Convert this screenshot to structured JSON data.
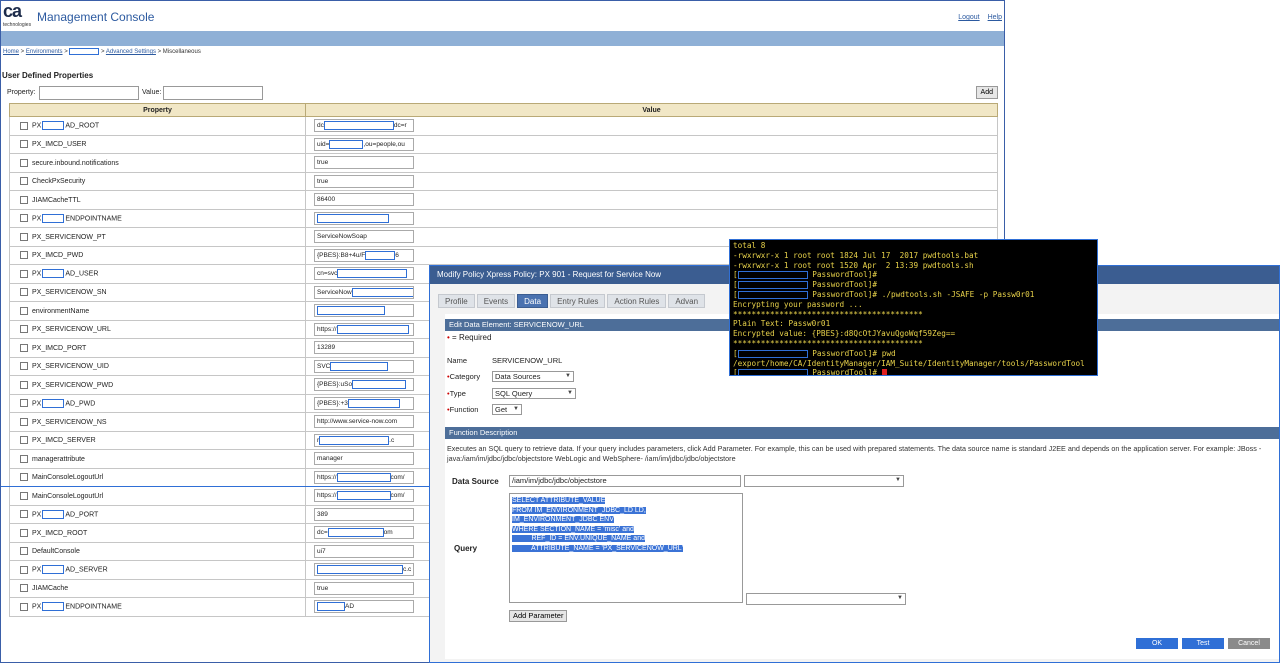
{
  "app": {
    "title": "Management Console",
    "logo_text": "ca",
    "logo_sub": "technologies",
    "links": [
      "Logout",
      "Help"
    ]
  },
  "breadcrumb": {
    "home": "Home",
    "environments": "Environments",
    "advanced": "Advanced Settings",
    "current": "Miscellaneous"
  },
  "udp": {
    "title": "User Defined Properties",
    "property_label": "Property:",
    "value_label": "Value:",
    "add_label": "Add",
    "col_property": "Property",
    "col_value": "Value"
  },
  "rows": [
    {
      "p1": "PX",
      "p2": "AD_ROOT",
      "v1": "dc",
      "v2": "dc=r"
    },
    {
      "p1": "PX_IMCD_USER",
      "p2": "",
      "v1": "uid=",
      "v2": ",ou=people,ou"
    },
    {
      "p1": "secure.inbound.notifications",
      "p2": "",
      "v1": "true",
      "v2": ""
    },
    {
      "p1": "CheckPxSecurity",
      "p2": "",
      "v1": "true",
      "v2": ""
    },
    {
      "p1": "JIAMCacheTTL",
      "p2": "",
      "v1": "86400",
      "v2": ""
    },
    {
      "p1": "PX",
      "p2": "ENDPOINTNAME",
      "v1": "",
      "v2": ""
    },
    {
      "p1": "PX_SERVICENOW_PT",
      "p2": "",
      "v1": "ServiceNowSoap",
      "v2": ""
    },
    {
      "p1": "PX_IMCD_PWD",
      "p2": "",
      "v1": "{PBES}:B8+4u/F",
      "v2": "6"
    },
    {
      "p1": "PX",
      "p2": "AD_USER",
      "v1": "cn=svc",
      "v2": ""
    },
    {
      "p1": "PX_SERVICENOW_SN",
      "p2": "",
      "v1": "ServiceNow",
      "v2": ""
    },
    {
      "p1": "environmentName",
      "p2": "",
      "v1": "",
      "v2": ""
    },
    {
      "p1": "PX_SERVICENOW_URL",
      "p2": "",
      "v1": "https://",
      "v2": ""
    },
    {
      "p1": "PX_IMCD_PORT",
      "p2": "",
      "v1": "13289",
      "v2": ""
    },
    {
      "p1": "PX_SERVICENOW_UID",
      "p2": "",
      "v1": "SVC",
      "v2": ""
    },
    {
      "p1": "PX_SERVICENOW_PWD",
      "p2": "",
      "v1": "{PBES}:uSo",
      "v2": ""
    },
    {
      "p1": "PX",
      "p2": "AD_PWD",
      "v1": "{PBES}:+3",
      "v2": ""
    },
    {
      "p1": "PX_SERVICENOW_NS",
      "p2": "",
      "v1": "http://www.service-now.com",
      "v2": ""
    },
    {
      "p1": "PX_IMCD_SERVER",
      "p2": "",
      "v1": "r",
      "v2": ".c"
    },
    {
      "p1": "managerattribute",
      "p2": "",
      "v1": "manager",
      "v2": ""
    },
    {
      "p1": "MainConsoleLogoutUrl",
      "p2": "",
      "v1": "https://",
      "v2": "com/"
    },
    {
      "p1": "MainConsoleLogoutUrl",
      "p2": "",
      "v1": "https://",
      "v2": "com/"
    },
    {
      "p1": "PX",
      "p2": "AD_PORT",
      "v1": "389",
      "v2": ""
    },
    {
      "p1": "PX_IMCD_ROOT",
      "p2": "",
      "v1": "dc=",
      "v2": "om"
    },
    {
      "p1": "DefaultConsole",
      "p2": "",
      "v1": "ui7",
      "v2": ""
    },
    {
      "p1": "PX",
      "p2": "AD_SERVER",
      "v1": "",
      "v2": "c.c"
    },
    {
      "p1": "JIAMCache",
      "p2": "",
      "v1": "true",
      "v2": ""
    },
    {
      "p1": "PX",
      "p2": "ENDPOINTNAME",
      "v1": "",
      "v2": "AD"
    }
  ],
  "dialog": {
    "title": "Modify Policy Xpress Policy: PX 901 - Request for Service Now",
    "tabs": [
      "Profile",
      "Events",
      "Data",
      "Entry Rules",
      "Action Rules",
      "Advan"
    ],
    "edit_heading": "Edit Data Element: SERVICENOW_URL",
    "required_note": "= Required",
    "name_label": "Name",
    "name_value": "SERVICENOW_URL",
    "category_label": "Category",
    "category_value": "Data Sources",
    "type_label": "Type",
    "type_value": "SQL Query",
    "function_label": "Function",
    "function_value": "Get",
    "fd_heading": "Function Description",
    "fd_text": "Executes an SQL query to retrieve data. If your query includes parameters, click Add Parameter. For example, this can be used with prepared statements. The data source name is standard J2EE and depends on the application server. For example: JBoss - java:/iam/im/jdbc/jdbc/objectstore WebLogic and WebSphere- /iam/im/jdbc/jdbc/objectstore",
    "ds_label": "Data Source",
    "ds_value": "/iam/im/jdbc/jdbc/objectstore",
    "query_label": "Query",
    "query_lines": [
      "SELECT ATTRIBUTE_VALUE",
      "FROM IM_ENVIRONMENT_JDBC_LD LD,",
      "IM_ENVIRONMENT_JDBC ENV",
      "WHERE SECTION_NAME = 'misc' and",
      "          REF_ID = ENV.UNIQUE_NAME and",
      "          ATTRIBUTE_NAME = 'PX_SERVICENOW_URL'"
    ],
    "add_param": "Add Parameter",
    "ok": "OK",
    "test": "Test",
    "cancel": "Cancel"
  },
  "terminal": {
    "lines": [
      {
        "pre": "",
        "red": false,
        "text": "total 8"
      },
      {
        "pre": "",
        "red": false,
        "text": "-rwxrwxr-x 1 root root 1824 Jul 17  2017 pwdtools.bat"
      },
      {
        "pre": "",
        "red": false,
        "text": "-rwxrwxr-x 1 root root 1520 Apr  2 13:39 pwdtools.sh"
      },
      {
        "pre": "[",
        "red": true,
        "text": " PasswordTool]#"
      },
      {
        "pre": "[",
        "red": true,
        "text": " PasswordTool]#"
      },
      {
        "pre": "[",
        "red": true,
        "text": " PasswordTool]# ./pwdtools.sh -JSAFE -p Passw0r01"
      },
      {
        "pre": "",
        "red": false,
        "text": "Encrypting your password ..."
      },
      {
        "pre": "",
        "red": false,
        "text": "*****************************************"
      },
      {
        "pre": "",
        "red": false,
        "text": "Plain Text: Passw0r01"
      },
      {
        "pre": "",
        "red": false,
        "text": "Encrypted value: {PBES}:d8QcOtJYavuQgoWqf59Zeg=="
      },
      {
        "pre": "",
        "red": false,
        "text": "*****************************************"
      },
      {
        "pre": "[",
        "red": true,
        "text": " PasswordTool]# pwd"
      },
      {
        "pre": "",
        "red": false,
        "text": "/export/home/CA/IdentityManager/IAM_Suite/IdentityManager/tools/PasswordTool"
      },
      {
        "pre": "[",
        "red": true,
        "text": " PasswordTool]# "
      }
    ]
  },
  "colors": {
    "brand_blue": "#2c5aa0",
    "header_bar": "#8fb0d6",
    "table_header": "#f1e7c6",
    "dialog_title": "#3b5d91",
    "section_bar": "#4d6e99",
    "terminal_text": "#e8d24a",
    "selection": "#3b73d6",
    "ok_button": "#2f6fd6",
    "cancel_button": "#8a8a8a"
  }
}
